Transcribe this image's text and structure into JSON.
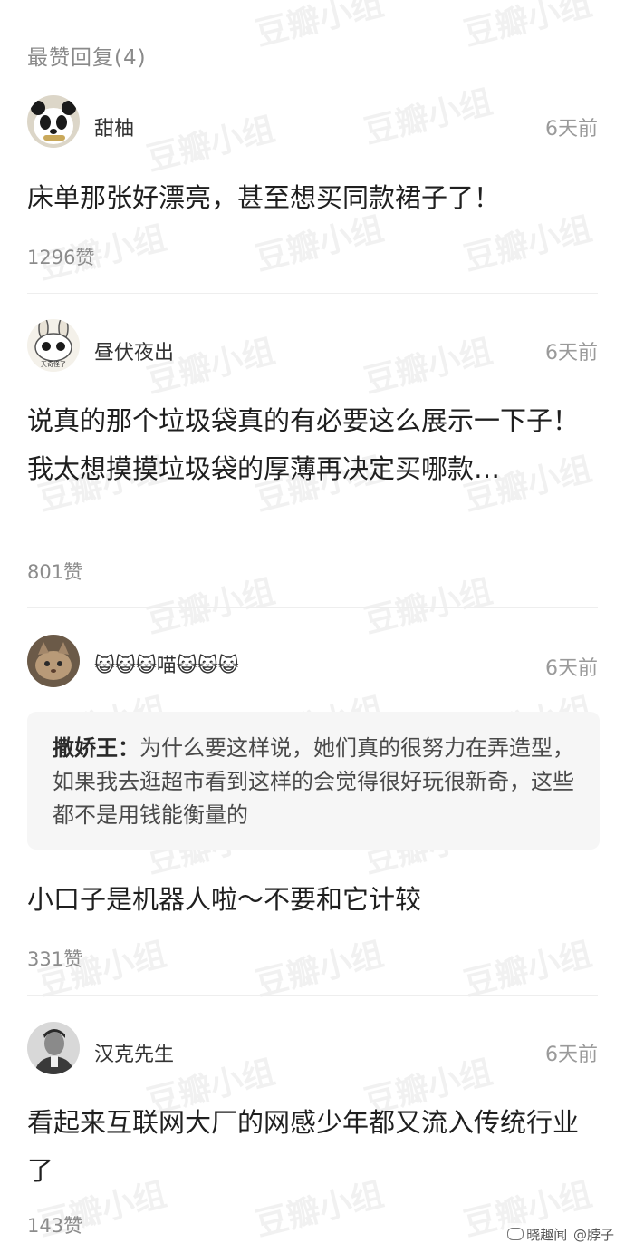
{
  "section": {
    "title": "最赞回复(4)"
  },
  "watermark": "豆瓣小组",
  "footer": {
    "source": "晓趣闻",
    "handle": "@脖子"
  },
  "comments": [
    {
      "username": "甜柚",
      "time": "6天前",
      "avatar": "panda-avatar",
      "text": "床单那张好漂亮，甚至想买同款裙子了！",
      "likes": "1296赞"
    },
    {
      "username": "昼伏夜出",
      "time": "6天前",
      "avatar": "cartoon-rabbit-avatar",
      "avatar_caption": "天奇怪了",
      "text": "说真的那个垃圾袋真的有必要这么展示一下子！我太想摸摸垃圾袋的厚薄再决定买哪款…",
      "likes": "801赞"
    },
    {
      "username": "😺😺😺喵😺😺😺",
      "time": "6天前",
      "avatar": "cat-photo-avatar",
      "quote": {
        "author": "撒娇王：",
        "text": "为什么要这样说，她们真的很努力在弄造型，如果我去逛超市看到这样的会觉得很好玩很新奇，这些都不是用钱能衡量的"
      },
      "text": "小口子是机器人啦～不要和它计较",
      "likes": "331赞"
    },
    {
      "username": "汉克先生",
      "time": "6天前",
      "avatar": "man-photo-avatar",
      "text": "看起来互联网大厂的网感少年都又流入传统行业了",
      "likes": "143赞"
    }
  ]
}
